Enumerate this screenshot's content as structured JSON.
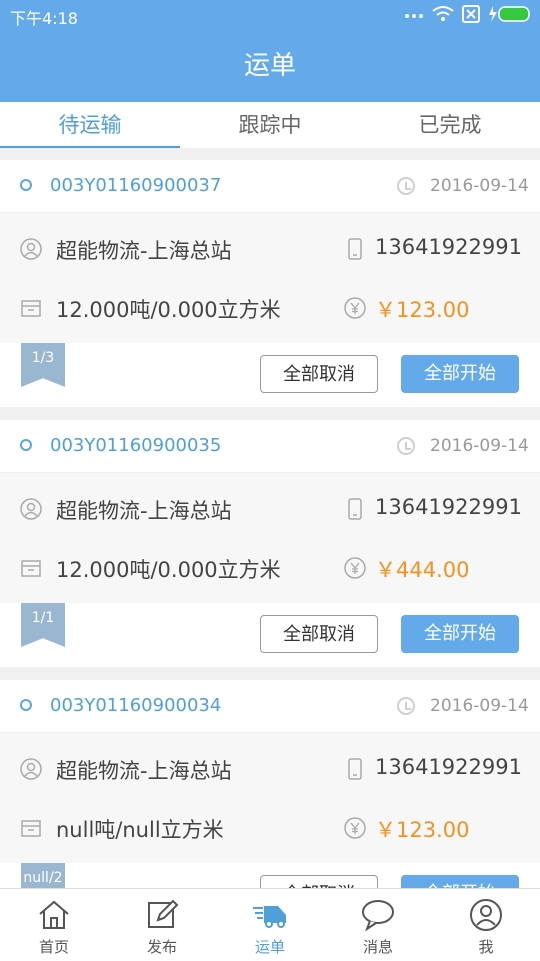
{
  "status_bar": {
    "time": "下午4:18",
    "icons": [
      "dots-icon",
      "wifi-icon",
      "sim-x-icon",
      "battery-charging-icon"
    ]
  },
  "app_bar": {
    "title": "运单"
  },
  "tabs": [
    {
      "label": "待运输",
      "active": true
    },
    {
      "label": "跟踪中",
      "active": false
    },
    {
      "label": "已完成",
      "active": false
    }
  ],
  "orders": [
    {
      "order_no": "003Y01160900037",
      "date": "2016-09-14",
      "company": "超能物流-上海总站",
      "phone": "13641922991",
      "cargo": "12.000吨/0.000立方米",
      "price": "￥123.00",
      "flag": "1/3",
      "cancel_label": "全部取消",
      "start_label": "全部开始"
    },
    {
      "order_no": "003Y01160900035",
      "date": "2016-09-14",
      "company": "超能物流-上海总站",
      "phone": "13641922991",
      "cargo": "12.000吨/0.000立方米",
      "price": "￥444.00",
      "flag": "1/1",
      "cancel_label": "全部取消",
      "start_label": "全部开始"
    },
    {
      "order_no": "003Y01160900034",
      "date": "2016-09-14",
      "company": "超能物流-上海总站",
      "phone": "13641922991",
      "cargo": "null吨/null立方米",
      "price": "￥123.00",
      "flag": "null/2",
      "cancel_label": "全部取消",
      "start_label": "全部开始"
    }
  ],
  "bottom_nav": [
    {
      "label": "首页",
      "icon": "home-icon",
      "active": false
    },
    {
      "label": "发布",
      "icon": "edit-icon",
      "active": false
    },
    {
      "label": "运单",
      "icon": "truck-icon",
      "active": true
    },
    {
      "label": "消息",
      "icon": "chat-icon",
      "active": false
    },
    {
      "label": "我",
      "icon": "user-icon",
      "active": false
    }
  ],
  "colors": {
    "primary": "#64a9e9",
    "accent_text": "#4f9fd8",
    "price": "#f3921f"
  }
}
